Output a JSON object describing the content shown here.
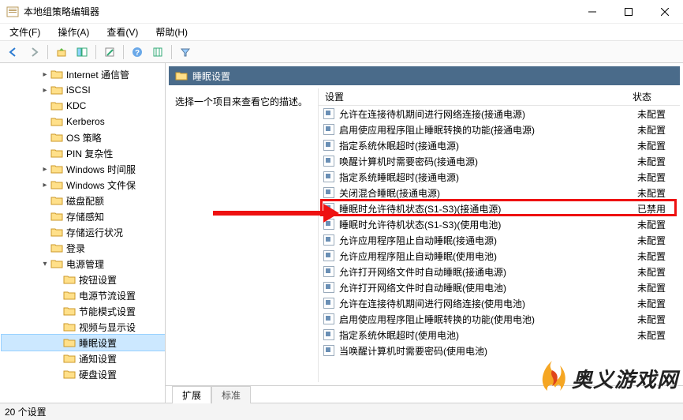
{
  "window": {
    "title": "本地组策略编辑器"
  },
  "menubar": [
    "文件(F)",
    "操作(A)",
    "查看(V)",
    "帮助(H)"
  ],
  "tree": [
    {
      "indent": 3,
      "expander": ">",
      "label": "Internet 通信管"
    },
    {
      "indent": 3,
      "expander": ">",
      "label": "iSCSI"
    },
    {
      "indent": 3,
      "expander": "",
      "label": "KDC"
    },
    {
      "indent": 3,
      "expander": "",
      "label": "Kerberos"
    },
    {
      "indent": 3,
      "expander": "",
      "label": "OS 策略"
    },
    {
      "indent": 3,
      "expander": "",
      "label": "PIN 复杂性"
    },
    {
      "indent": 3,
      "expander": ">",
      "label": "Windows 时间服"
    },
    {
      "indent": 3,
      "expander": ">",
      "label": "Windows 文件保"
    },
    {
      "indent": 3,
      "expander": "",
      "label": "磁盘配额"
    },
    {
      "indent": 3,
      "expander": "",
      "label": "存储感知"
    },
    {
      "indent": 3,
      "expander": "",
      "label": "存储运行状况"
    },
    {
      "indent": 3,
      "expander": "",
      "label": "登录"
    },
    {
      "indent": 3,
      "expander": "v",
      "label": "电源管理"
    },
    {
      "indent": 4,
      "expander": "",
      "label": "按钮设置"
    },
    {
      "indent": 4,
      "expander": "",
      "label": "电源节流设置"
    },
    {
      "indent": 4,
      "expander": "",
      "label": "节能模式设置"
    },
    {
      "indent": 4,
      "expander": "",
      "label": "视频与显示设"
    },
    {
      "indent": 4,
      "expander": "",
      "label": "睡眠设置",
      "selected": true
    },
    {
      "indent": 4,
      "expander": "",
      "label": "通知设置"
    },
    {
      "indent": 4,
      "expander": "",
      "label": "硬盘设置"
    }
  ],
  "detail": {
    "path_label": "睡眠设置",
    "desc_prompt": "选择一个项目来查看它的描述。",
    "col_setting": "设置",
    "col_state": "状态",
    "items": [
      {
        "text": "允许在连接待机期间进行网络连接(接通电源)",
        "state": "未配置"
      },
      {
        "text": "启用使应用程序阻止睡眠转换的功能(接通电源)",
        "state": "未配置"
      },
      {
        "text": "指定系统休眠超时(接通电源)",
        "state": "未配置"
      },
      {
        "text": "唤醒计算机时需要密码(接通电源)",
        "state": "未配置"
      },
      {
        "text": "指定系统睡眠超时(接通电源)",
        "state": "未配置"
      },
      {
        "text": "关闭混合睡眠(接通电源)",
        "state": "未配置"
      },
      {
        "text": "睡眠时允许待机状态(S1-S3)(接通电源)",
        "state": "已禁用",
        "highlight": true
      },
      {
        "text": "睡眠时允许待机状态(S1-S3)(使用电池)",
        "state": "未配置"
      },
      {
        "text": "允许应用程序阻止自动睡眠(接通电源)",
        "state": "未配置"
      },
      {
        "text": "允许应用程序阻止自动睡眠(使用电池)",
        "state": "未配置"
      },
      {
        "text": "允许打开网络文件时自动睡眠(接通电源)",
        "state": "未配置"
      },
      {
        "text": "允许打开网络文件时自动睡眠(使用电池)",
        "state": "未配置"
      },
      {
        "text": "允许在连接待机期间进行网络连接(使用电池)",
        "state": "未配置"
      },
      {
        "text": "启用使应用程序阻止睡眠转换的功能(使用电池)",
        "state": "未配置"
      },
      {
        "text": "指定系统休眠超时(使用电池)",
        "state": "未配置"
      },
      {
        "text": "当唤醒计算机时需要密码(使用电池)",
        "state": ""
      }
    ],
    "tabs": {
      "extended": "扩展",
      "standard": "标准"
    }
  },
  "statusbar": "20 个设置",
  "watermark": "奥义游戏网"
}
